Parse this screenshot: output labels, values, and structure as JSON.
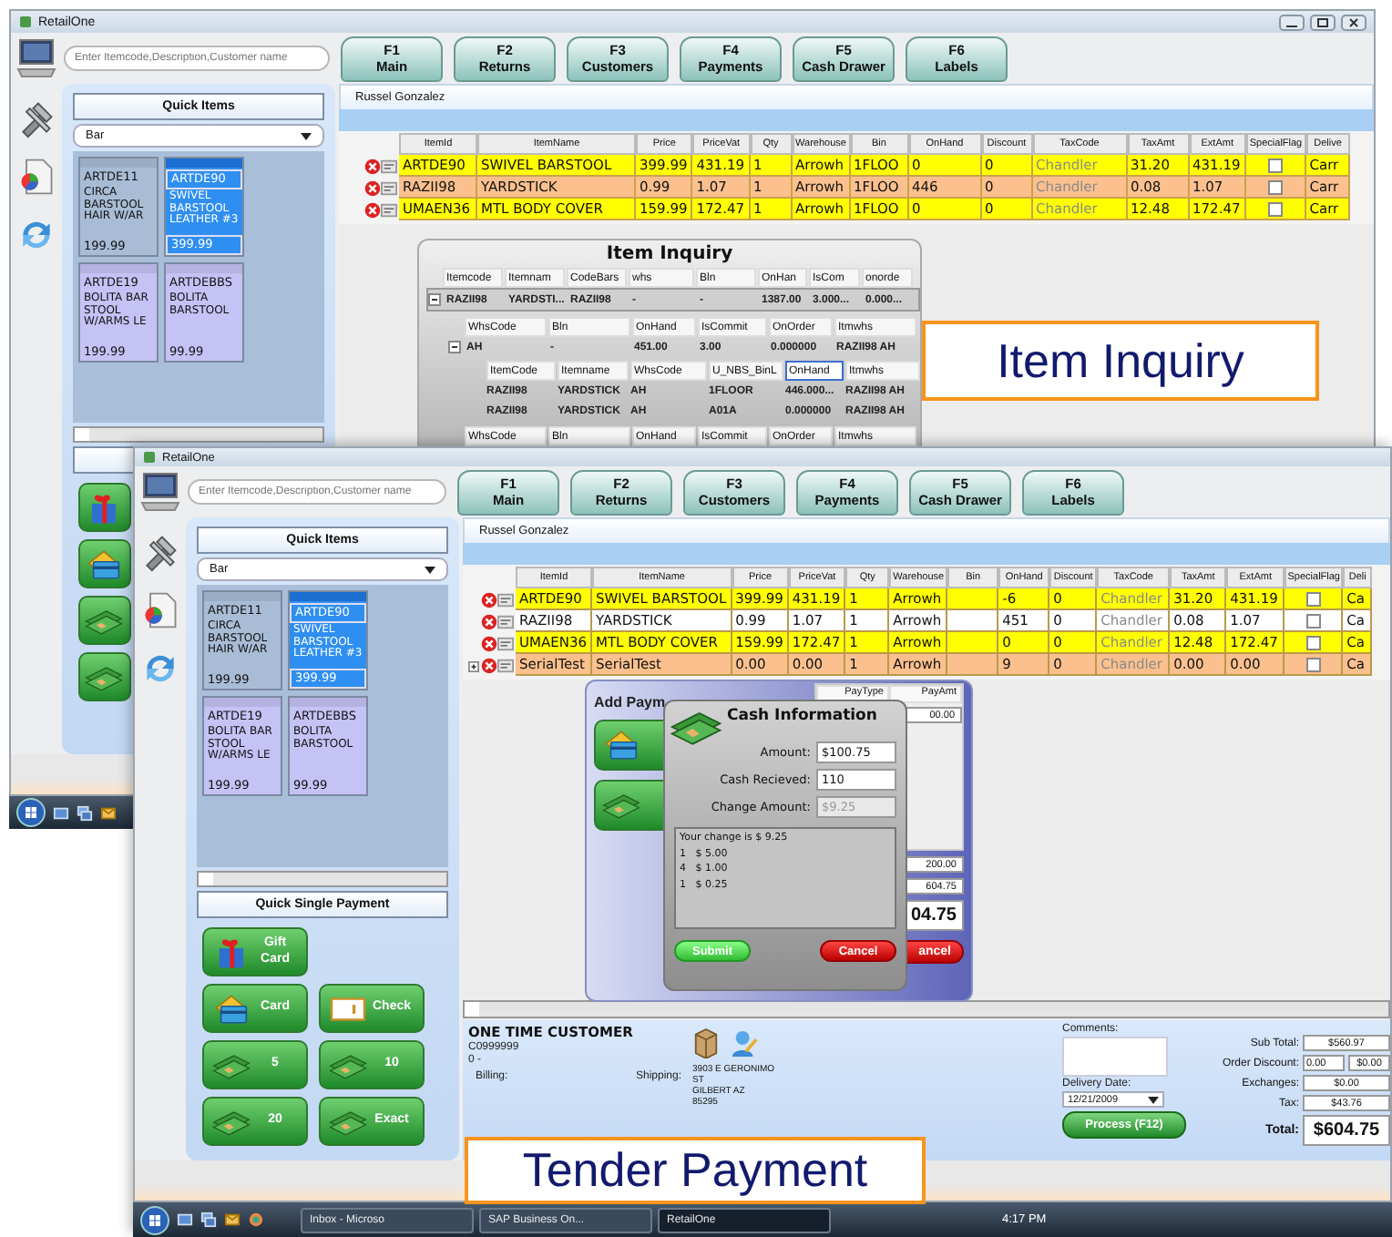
{
  "back_window": {
    "title": "RetailOne",
    "search": {
      "placeholder": "Enter Itemcode,Description,Customer name"
    },
    "function_keys": [
      {
        "key": "F1",
        "label": "Main"
      },
      {
        "key": "F2",
        "label": "Returns"
      },
      {
        "key": "F3",
        "label": "Customers"
      },
      {
        "key": "F4",
        "label": "Payments"
      },
      {
        "key": "F5",
        "label": "Cash Drawer"
      },
      {
        "key": "F6",
        "label": "Labels"
      }
    ],
    "quick_items": {
      "title": "Quick Items",
      "category": "Bar",
      "items": [
        {
          "code": "ARTDE11",
          "name": "CIRCA BARSTOOL HAIR W/AR",
          "price": "199.99",
          "selected": false,
          "color": "#a9bcd6"
        },
        {
          "code": "ARTDE90",
          "name": "SWIVEL BARSTOOL LEATHER #3",
          "price": "399.99",
          "selected": true,
          "color": "#2f8ff0"
        },
        {
          "code": "ARTDE19",
          "name": "BOLITA BAR STOOL W/ARMS LE",
          "price": "199.99",
          "selected": false,
          "color": "#c5c2f5"
        },
        {
          "code": "ARTDEBBS",
          "name": "BOLITA BARSTOOL",
          "price": "99.99",
          "selected": false,
          "color": "#c5c2f5"
        }
      ]
    },
    "payment_buttons": [
      {
        "kind": "gift"
      },
      {
        "kind": "card"
      },
      {
        "kind": "cash"
      },
      {
        "kind": "cash"
      }
    ],
    "customer_name": "Russel Gonzalez",
    "grid": {
      "columns": [
        "ItemId",
        "ItemName",
        "Price",
        "PriceVat",
        "Qty",
        "Warehouse",
        "Bin",
        "OnHand",
        "Discount",
        "TaxCode",
        "TaxAmt",
        "ExtAmt",
        "SpecialFlag",
        "Delive"
      ],
      "rows": [
        {
          "color": "#ffff00",
          "expander": false,
          "cells": [
            "ARTDE90",
            "SWIVEL BARSTOOL",
            "399.99",
            "431.19",
            "1",
            "Arrowh",
            "1FLOO",
            "0",
            "0",
            "Chandler",
            "31.20",
            "431.19"
          ],
          "special_flag": false,
          "delivery": "Carr"
        },
        {
          "color": "#fbc08e",
          "expander": false,
          "cells": [
            "RAZII98",
            "YARDSTICK",
            "0.99",
            "1.07",
            "1",
            "Arrowh",
            "1FLOO",
            "446",
            "0",
            "Chandler",
            "0.08",
            "1.07"
          ],
          "special_flag": false,
          "delivery": "Carr"
        },
        {
          "color": "#ffff00",
          "expander": false,
          "cells": [
            "UMAEN36",
            "MTL BODY COVER",
            "159.99",
            "172.47",
            "1",
            "Arrowh",
            "1FLOO",
            "0",
            "0",
            "Chandler",
            "12.48",
            "172.47"
          ],
          "special_flag": false,
          "delivery": "Carr"
        }
      ]
    },
    "item_inquiry": {
      "title": "Item Inquiry",
      "columns": [
        "Itemcode",
        "Itemnam",
        "CodeBars",
        "whs",
        "Bln",
        "OnHan",
        "IsCom",
        "onorde"
      ],
      "rows": [
        {
          "cells": [
            "RAZII98",
            "YARDSTI...",
            "RAZII98",
            "-",
            "-",
            "1387.00",
            "3.000...",
            "0.000..."
          ],
          "expanded": true,
          "children": [
            {
              "columns": [
                "WhsCode",
                "Bln",
                "OnHand",
                "IsCommit",
                "OnOrder",
                "Itmwhs"
              ],
              "rows": [
                {
                  "cells": [
                    "AH",
                    "-",
                    "451.00",
                    "3.00",
                    "0.000000",
                    "RAZII98 AH"
                  ],
                  "expanded": true,
                  "children": [
                    {
                      "columns": [
                        {
                          "label": "ItemCode",
                          "selected": false
                        },
                        {
                          "label": "Itemname",
                          "selected": false
                        },
                        {
                          "label": "WhsCode",
                          "selected": false
                        },
                        {
                          "label": "U_NBS_BinL",
                          "selected": false
                        },
                        {
                          "label": "OnHand",
                          "selected": true
                        },
                        {
                          "label": "Itmwhs",
                          "selected": false
                        }
                      ],
                      "rows": [
                        {
                          "cells": [
                            "RAZII98",
                            "YARDSTICK",
                            "AH",
                            "1FLOOR",
                            "446.000...",
                            "RAZII98 AH"
                          ]
                        },
                        {
                          "cells": [
                            "RAZII98",
                            "YARDSTICK",
                            "AH",
                            "A01A",
                            "0.000000",
                            "RAZII98 AH"
                          ]
                        }
                      ]
                    }
                  ]
                }
              ]
            },
            {
              "columns": [
                "WhsCode",
                "Bln",
                "OnHand",
                "IsCommit",
                "OnOrder",
                "Itmwhs"
              ]
            }
          ]
        }
      ]
    }
  },
  "front_window": {
    "title": "RetailOne",
    "search": {
      "placeholder": "Enter Itemcode,Description,Customer name"
    },
    "function_keys": [
      {
        "key": "F1",
        "label": "Main"
      },
      {
        "key": "F2",
        "label": "Returns"
      },
      {
        "key": "F3",
        "label": "Customers"
      },
      {
        "key": "F4",
        "label": "Payments"
      },
      {
        "key": "F5",
        "label": "Cash Drawer"
      },
      {
        "key": "F6",
        "label": "Labels"
      }
    ],
    "quick_items": {
      "title": "Quick Items",
      "category": "Bar",
      "items": [
        {
          "code": "ARTDE11",
          "name": "CIRCA BARSTOOL HAIR W/AR",
          "price": "199.99",
          "selected": false,
          "color": "#a9bcd6"
        },
        {
          "code": "ARTDE90",
          "name": "SWIVEL BARSTOOL LEATHER #3",
          "price": "399.99",
          "selected": true,
          "color": "#2f8ff0"
        },
        {
          "code": "ARTDE19",
          "name": "BOLITA BAR STOOL W/ARMS LE",
          "price": "199.99",
          "selected": false,
          "color": "#c5c2f5"
        },
        {
          "code": "ARTDEBBS",
          "name": "BOLITA BARSTOOL",
          "price": "99.99",
          "selected": false,
          "color": "#c5c2f5"
        }
      ]
    },
    "quick_single_payment": {
      "title": "Quick Single Payment",
      "buttons": [
        {
          "kind": "gift",
          "label": "Gift Card"
        },
        {
          "kind": "card",
          "label": "Card"
        },
        {
          "kind": "check",
          "label": "Check"
        },
        {
          "kind": "cash",
          "label": "5"
        },
        {
          "kind": "cash",
          "label": "10"
        },
        {
          "kind": "cash",
          "label": "20"
        },
        {
          "kind": "cash",
          "label": "Exact"
        }
      ]
    },
    "customer_name": "Russel Gonzalez",
    "grid": {
      "columns": [
        "ItemId",
        "ItemName",
        "Price",
        "PriceVat",
        "Qty",
        "Warehouse",
        "Bin",
        "OnHand",
        "Discount",
        "TaxCode",
        "TaxAmt",
        "ExtAmt",
        "SpecialFlag",
        "Deli"
      ],
      "rows": [
        {
          "color": "#ffff00",
          "expander": false,
          "cells": [
            "ARTDE90",
            "SWIVEL BARSTOOL",
            "399.99",
            "431.19",
            "1",
            "Arrowh",
            null,
            "-6",
            "0",
            "Chandler",
            "31.20",
            "431.19"
          ],
          "special_flag": false,
          "delivery": "Ca"
        },
        {
          "color": "#ffffff",
          "expander": false,
          "cells": [
            "RAZII98",
            "YARDSTICK",
            "0.99",
            "1.07",
            "1",
            "Arrowh",
            null,
            "451",
            "0",
            "Chandler",
            "0.08",
            "1.07"
          ],
          "special_flag": false,
          "delivery": "Ca"
        },
        {
          "color": "#ffff00",
          "expander": false,
          "cells": [
            "UMAEN36",
            "MTL BODY COVER",
            "159.99",
            "172.47",
            "1",
            "Arrowh",
            null,
            "0",
            "0",
            "Chandler",
            "12.48",
            "172.47"
          ],
          "special_flag": false,
          "delivery": "Ca"
        },
        {
          "color": "#fbc08e",
          "expander": true,
          "cells": [
            "SerialTest",
            "SerialTest",
            "0.00",
            "0.00",
            "1",
            "Arrowh",
            null,
            "9",
            "0",
            "Chandler",
            "0.00",
            "0.00"
          ],
          "special_flag": false,
          "delivery": "Ca"
        }
      ]
    },
    "add_payment": {
      "title": "Add Paym",
      "columns": [
        "PayType",
        "PayAmt"
      ],
      "pay_amount": "00.00",
      "fields": [
        "200.00",
        "604.75"
      ],
      "total": "04.75",
      "cancel": "ancel"
    },
    "cash_information": {
      "title": "Cash Information",
      "fields": [
        {
          "label": "Amount:",
          "value": "$100.75",
          "disabled": false
        },
        {
          "label": "Cash Recieved:",
          "value": "110",
          "disabled": false
        },
        {
          "label": "Change Amount:",
          "value": "$9.25",
          "disabled": true
        }
      ],
      "change_lines": [
        "Your change is $ 9.25",
        "1   $ 5.00",
        "4   $ 1.00",
        "1   $ 0.25"
      ],
      "submit": "Submit",
      "cancel": "Cancel"
    },
    "customer": {
      "name": "ONE TIME CUSTOMER",
      "code": "C0999999",
      "line": "0 -",
      "billing": "Billing:",
      "shipping": "Shipping:",
      "address": [
        "3903 E GERONIMO",
        "ST",
        "GILBERT  AZ",
        "85295"
      ]
    },
    "order": {
      "comments": "Comments:",
      "delivery_date_label": "Delivery Date:",
      "delivery_date": "12/21/2009",
      "process": "Process (F12)",
      "sub_total": {
        "label": "Sub Total:",
        "value": "$560.97"
      },
      "order_discount": {
        "label": "Order Discount:",
        "percent": "0.00",
        "value": "$0.00"
      },
      "exchanges": {
        "label": "Exchanges:",
        "value": "$0.00"
      },
      "tax": {
        "label": "Tax:",
        "value": "$43.76"
      },
      "total": {
        "label": "Total:",
        "value": "$604.75"
      }
    },
    "taskbar": {
      "tasks": [
        {
          "label": "Inbox - Microso",
          "selected": false
        },
        {
          "label": "SAP Business On...",
          "selected": false
        },
        {
          "label": "RetailOne",
          "selected": true
        }
      ],
      "clock": "4:17 PM"
    }
  },
  "callouts": [
    {
      "label": "Item Inquiry"
    },
    {
      "label": "Tender Payment"
    }
  ]
}
